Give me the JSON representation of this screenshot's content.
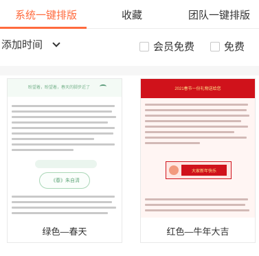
{
  "tabs": [
    {
      "label": "系统一键排版",
      "active": true
    },
    {
      "label": "收藏",
      "active": false
    },
    {
      "label": "团队一键排版",
      "active": false
    }
  ],
  "filters": {
    "sort_label": "添加时间",
    "member_free_label": "会员免费",
    "free_label": "免费"
  },
  "templates": [
    {
      "caption": "绿色—春天",
      "header_text": "盼望着，盼望着，春天的脚步近了",
      "badge_text": "《春》朱自清"
    },
    {
      "caption": "红色—牛年大吉",
      "header_text": "2021春节一份礼物送给您",
      "badge_text": "大家新年快乐"
    }
  ],
  "colors": {
    "accent": "#ff6a3d",
    "green_theme": "#62a77b",
    "red_theme": "#d0121b"
  }
}
